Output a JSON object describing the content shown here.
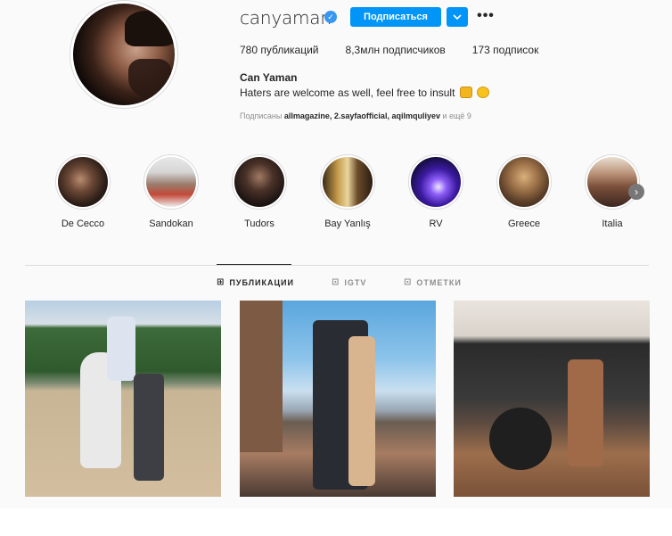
{
  "profile": {
    "username": "canyaman",
    "verified_glyph": "✓",
    "follow_label": "Подписаться",
    "dropdown_icon": "chevron-down-icon",
    "more_icon": "more-options-icon",
    "more_glyph": "•••",
    "full_name": "Can Yaman",
    "bio": "Haters are welcome as well, feel free to insult",
    "bio_emojis": [
      "crown-emoji",
      "smile-emoji"
    ],
    "followed_by_prefix": "Подписаны",
    "followed_by_users": "allmagazine, 2.sayfaofficial, aqilmquliyev",
    "followed_by_suffix": "и ещё 9"
  },
  "stats": {
    "posts_value": "780",
    "posts_label": "публикаций",
    "followers_value": "8,3млн",
    "followers_label": "подписчиков",
    "following_value": "173",
    "following_label": "подписок"
  },
  "highlights": [
    {
      "label": "De Cecco"
    },
    {
      "label": "Sandokan"
    },
    {
      "label": "Tudors"
    },
    {
      "label": "Bay Yanlış"
    },
    {
      "label": "RV"
    },
    {
      "label": "Greece"
    },
    {
      "label": "Italia"
    }
  ],
  "highlights_next_glyph": "›",
  "tabs": [
    {
      "label": "ПУБЛИКАЦИИ",
      "icon": "grid-icon",
      "glyph": "⊞",
      "active": true
    },
    {
      "label": "IGTV",
      "icon": "igtv-icon",
      "glyph": "⊡",
      "active": false
    },
    {
      "label": "ОТМЕТКИ",
      "icon": "tagged-icon",
      "glyph": "⊡",
      "active": false
    }
  ],
  "colors": {
    "accent": "#0095f6",
    "verified": "#3897f0",
    "text": "#262626",
    "muted": "#8e8e8e",
    "border": "#dbdbdb",
    "background": "#fafafa"
  }
}
